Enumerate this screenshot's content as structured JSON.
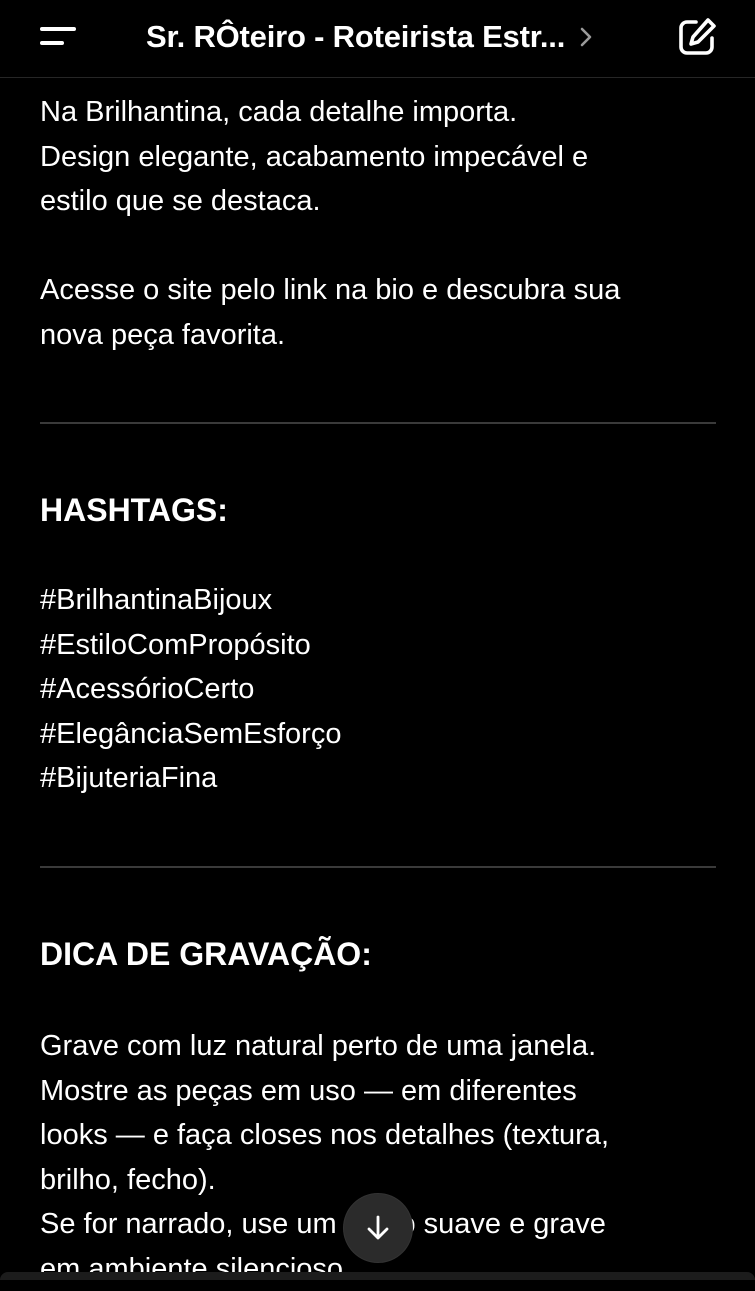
{
  "header": {
    "title": "Sr. RÔteiro - Roteirista Estr...",
    "menu_icon": "menu-icon",
    "chevron_icon": "chevron-right-icon",
    "edit_icon": "new-chat-edit-icon"
  },
  "content": {
    "intro_paragraph": "Na Brilhantina, cada detalhe importa.\nDesign elegante, acabamento impecável e\nestilo que se destaca.",
    "cta_paragraph": "Acesse o site pelo link na bio e descubra sua\nnova peça favorita.",
    "hashtags_heading": "HASHTAGS:",
    "hashtags": [
      "#BrilhantinaBijoux",
      "#EstiloComPropósito",
      "#AcessórioCerto",
      "#ElegânciaSemEsforço",
      "#BijuteriaFina"
    ],
    "tip_heading": "DICA DE GRAVAÇÃO:",
    "tip_paragraph": "Grave com luz natural perto de uma janela.\nMostre as peças em uso — em diferentes\nlooks — e faça closes nos detalhes (textura,\nbrilho, fecho).\nSe for narrado, use um áudio suave e grave\nem ambiente silencioso."
  },
  "scroll_button": {
    "icon": "arrow-down-icon"
  },
  "colors": {
    "background": "#000000",
    "text": "#ffffff",
    "divider": "#3a3a3a",
    "button_bg": "#2b2b2b"
  }
}
